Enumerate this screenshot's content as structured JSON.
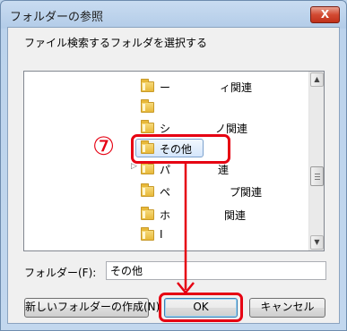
{
  "window": {
    "title": "フォルダーの参照",
    "close_label": "X"
  },
  "instruction": "ファイル検索するフォルダを選択する",
  "tree": {
    "rows": [
      {
        "prefix": "ー",
        "suffix": "ィ関連"
      },
      {
        "prefix": "",
        "suffix": ""
      },
      {
        "prefix": "シ",
        "suffix": "ノ関連"
      },
      {
        "label": "その他",
        "selected": true
      },
      {
        "prefix": "パ",
        "suffix": "連",
        "expandable": true
      },
      {
        "prefix": "ペ",
        "suffix": "プ関連"
      },
      {
        "prefix": "ホ",
        "suffix": "関連"
      },
      {
        "prefix": "I",
        "suffix": ""
      }
    ],
    "expander_icon": "▷",
    "scroll_up_icon": "▲",
    "scroll_down_icon": "▼"
  },
  "folder_field": {
    "label": "フォルダー(F):",
    "value": "その他"
  },
  "buttons": {
    "new_folder": "新しいフォルダーの作成(N)",
    "ok": "OK",
    "cancel": "キャンセル"
  },
  "annotation": {
    "step_number": "⑦",
    "color": "#e60012"
  }
}
